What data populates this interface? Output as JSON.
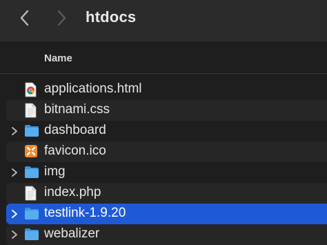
{
  "window": {
    "title": "htdocs"
  },
  "toolbar": {
    "back_icon": "chevron-left-icon",
    "forward_icon": "chevron-right-icon"
  },
  "columns": {
    "name": "Name"
  },
  "files": [
    {
      "name": "applications.html",
      "icon": "chrome-html-file-icon",
      "expandable": false,
      "selected": false
    },
    {
      "name": "bitnami.css",
      "icon": "document-icon",
      "expandable": false,
      "selected": false
    },
    {
      "name": "dashboard",
      "icon": "folder-icon",
      "expandable": true,
      "selected": false
    },
    {
      "name": "favicon.ico",
      "icon": "xampp-icon",
      "expandable": false,
      "selected": false
    },
    {
      "name": "img",
      "icon": "folder-icon",
      "expandable": true,
      "selected": false
    },
    {
      "name": "index.php",
      "icon": "document-icon",
      "expandable": false,
      "selected": false
    },
    {
      "name": "testlink-1.9.20",
      "icon": "folder-icon",
      "expandable": true,
      "selected": true
    },
    {
      "name": "webalizer",
      "icon": "folder-icon",
      "expandable": true,
      "selected": false
    }
  ],
  "colors": {
    "selection": "#1f5ad6",
    "folder": "#4aa3e8",
    "background": "#1e1e1e",
    "toolbar": "#2b2b2b"
  }
}
